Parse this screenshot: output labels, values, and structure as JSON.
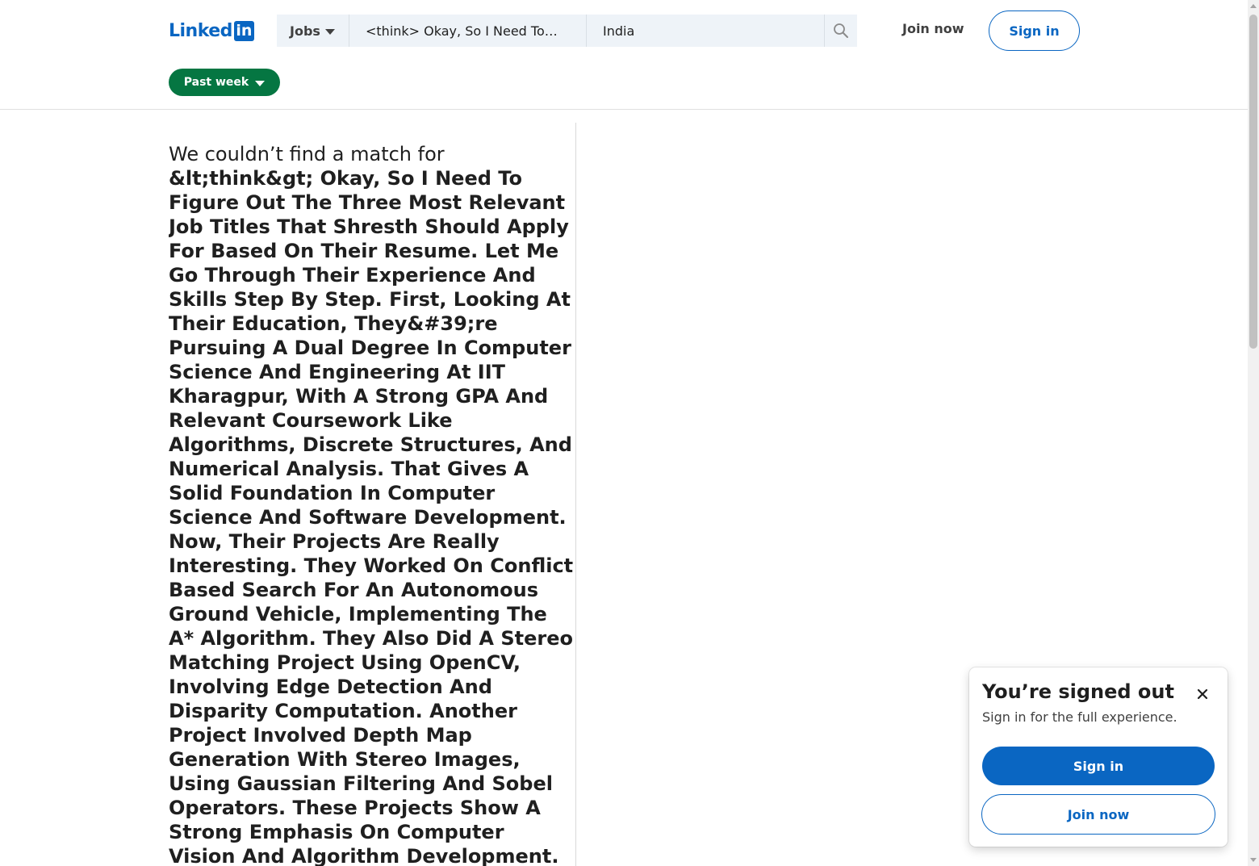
{
  "header": {
    "logo_text": "Linked",
    "logo_box": "in",
    "search": {
      "category": "Jobs",
      "keywords_value": "<think> Okay, So I Need To…",
      "location_value": "India"
    },
    "join_now": "Join now",
    "sign_in": "Sign in"
  },
  "filters": {
    "date_posted": "Past week"
  },
  "results": {
    "no_match_lead": "We couldn’t find a match for",
    "query": "&lt;think&gt; Okay, So I Need To Figure Out The Three Most Relevant Job Titles That Shresth Should Apply For Based On Their Resume. Let Me Go Through Their Experience And Skills Step By Step. First, Looking At Their Education, They&#39;re Pursuing A Dual Degree In Computer Science And Engineering At IIT Kharagpur, With A Strong GPA And Relevant Coursework Like Algorithms, Discrete Structures, And Numerical Analysis. That Gives A Solid Foundation In Computer Science And Software Development. Now, Their Projects Are Really Interesting. They Worked On Conflict Based Search For An Autonomous Ground Vehicle, Implementing The A* Algorithm. They Also Did A Stereo Matching Project Using OpenCV, Involving Edge Detection And Disparity Computation. Another Project Involved Depth Map Generation With Stereo Images, Using Gaussian Filtering And Sobel Operators. These Projects Show A Strong Emphasis On Computer Vision And Algorithm Development."
  },
  "modal": {
    "title": "You’re signed out",
    "subtitle": "Sign in for the full experience.",
    "sign_in": "Sign in",
    "join_now": "Join now"
  },
  "colors": {
    "brand": "#0a66c2",
    "filter_active": "#057642",
    "search_bg": "#eef3f8"
  }
}
